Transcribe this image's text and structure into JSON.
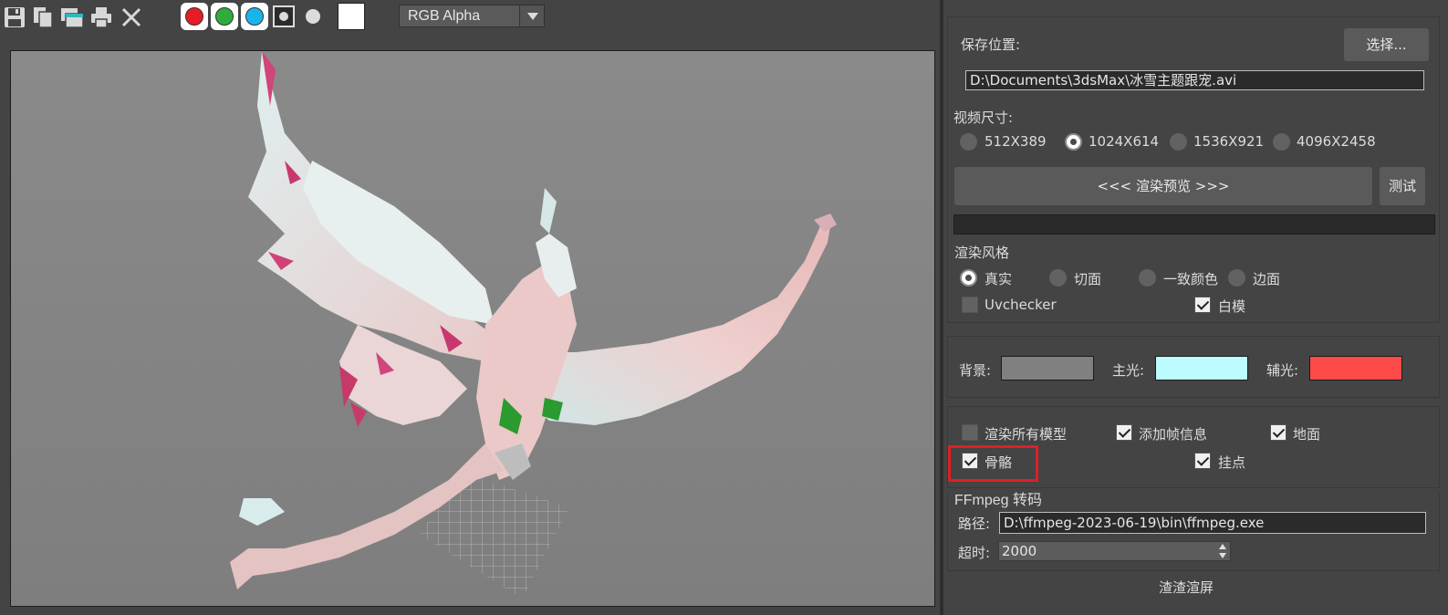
{
  "toolbar": {
    "icons": [
      "save-icon",
      "copy-icon",
      "clone-window-icon",
      "print-icon",
      "clear-icon"
    ],
    "channel_buttons": [
      {
        "name": "red-channel",
        "color": "#e81c24"
      },
      {
        "name": "green-channel",
        "color": "#2ead3a"
      },
      {
        "name": "blue-channel",
        "color": "#1ab4ec"
      }
    ],
    "channel_display": "RGB Alpha",
    "swatch_color": "#ffffff"
  },
  "panel": {
    "save_location_label": "保存位置:",
    "choose_button": "选择...",
    "save_path": "D:\\Documents\\3dsMax\\冰雪主题跟宠.avi",
    "video_size_label": "视频尺寸:",
    "sizes": [
      {
        "label": "512X389",
        "selected": false
      },
      {
        "label": "1024X614",
        "selected": true
      },
      {
        "label": "1536X921",
        "selected": false
      },
      {
        "label": "4096X2458",
        "selected": false
      }
    ],
    "render_preview_button": "<<<  渲染预览  >>>",
    "test_button": "测试",
    "progress": 0,
    "render_style_label": "渲染风格",
    "styles": [
      {
        "label": "真实",
        "selected": true
      },
      {
        "label": "切面",
        "selected": false
      },
      {
        "label": "一致颜色",
        "selected": false
      },
      {
        "label": "边面",
        "selected": false
      }
    ],
    "uvchecker_label": "Uvchecker",
    "uvchecker_checked": false,
    "white_model_label": "白模",
    "white_model_checked": true,
    "background_label": "背景:",
    "background_color": "#808080",
    "key_light_label": "主光:",
    "key_light_color": "#bcfcff",
    "fill_light_label": "辅光:",
    "fill_light_color": "#ff4a4a",
    "options": [
      {
        "label": "渲染所有模型",
        "checked": false
      },
      {
        "label": "添加帧信息",
        "checked": true
      },
      {
        "label": "地面",
        "checked": true
      },
      {
        "label": "骨骼",
        "checked": true
      },
      {
        "label": "挂点",
        "checked": true
      }
    ],
    "ffmpeg_label": "FFmpeg 转码",
    "path_label": "路径:",
    "ffmpeg_path": "D:\\ffmpeg-2023-06-19\\bin\\ffmpeg.exe",
    "timeout_label": "超时:",
    "timeout_value": "2000",
    "footer": "渣渣渲屏"
  },
  "highlight_color": "#e01e26"
}
